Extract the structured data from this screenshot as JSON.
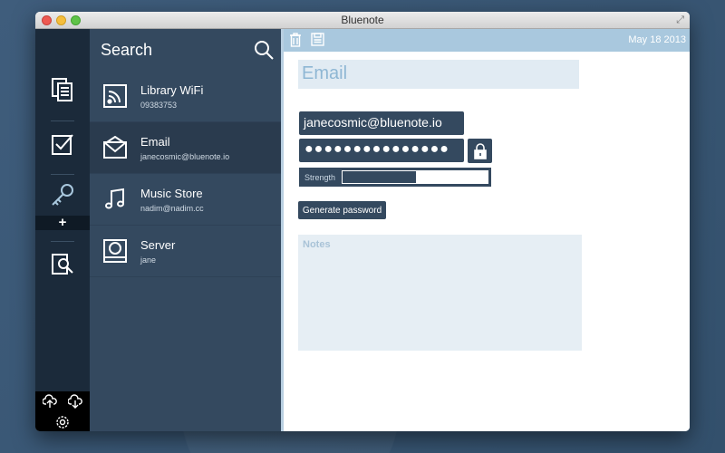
{
  "window": {
    "title": "Bluenote"
  },
  "rail": {
    "items": [
      {
        "icon": "notes-icon"
      },
      {
        "icon": "checklist-icon"
      },
      {
        "icon": "key-icon"
      },
      {
        "icon": "search-document-icon"
      }
    ],
    "add_label": "+",
    "bottom": [
      {
        "icon": "cloud-upload-icon"
      },
      {
        "icon": "cloud-download-icon"
      },
      {
        "icon": "gear-icon"
      }
    ]
  },
  "list": {
    "title": "Search",
    "items": [
      {
        "title": "Library WiFi",
        "subtitle": "09383753",
        "icon": "wifi-icon"
      },
      {
        "title": "Email",
        "subtitle": "janecosmic@bluenote.io",
        "icon": "envelope-icon"
      },
      {
        "title": "Music Store",
        "subtitle": "nadim@nadim.cc",
        "icon": "music-note-icon"
      },
      {
        "title": "Server",
        "subtitle": "jane",
        "icon": "server-icon"
      }
    ],
    "selected_index": 1
  },
  "detail": {
    "date": "May 18 2013",
    "title": "Email",
    "username": "janecosmic@bluenote.io",
    "password_mask": "●●●●●●●●●●●●●●●",
    "strength_label": "Strength",
    "strength_level": 0.5,
    "generate_label": "Generate password",
    "notes_placeholder": "Notes"
  },
  "colors": {
    "accent": "#34495f",
    "rail": "#1b2a3a",
    "toolbar": "#a9c8de"
  }
}
